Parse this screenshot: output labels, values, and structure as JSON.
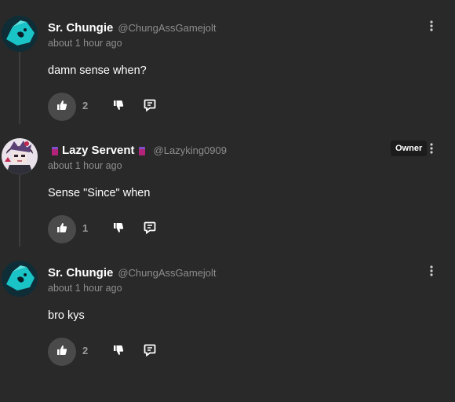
{
  "colors": {
    "background": "#292929",
    "muted_text": "#8d8d8d",
    "like_button_bg": "#4a4a4a",
    "owner_badge_bg": "#1c1c1c",
    "tag_magenta": "#b2247a",
    "tag_purple": "#7d4ec7"
  },
  "comments": [
    {
      "display_name": "Sr. Chungie",
      "username": "@ChungAssGamejolt",
      "timestamp": "about 1 hour ago",
      "body": "damn sense when?",
      "likes": "2",
      "avatar_icon": "teal-creature-avatar",
      "name_decorations": false,
      "badge": ""
    },
    {
      "display_name": "Lazy Servent",
      "username": "@Lazyking0909",
      "timestamp": "about 1 hour ago",
      "body": "Sense \"Since\" when",
      "likes": "1",
      "avatar_icon": "anime-character-avatar",
      "name_decorations": true,
      "badge": "Owner"
    },
    {
      "display_name": "Sr. Chungie",
      "username": "@ChungAssGamejolt",
      "timestamp": "about 1 hour ago",
      "body": "bro kys",
      "likes": "2",
      "avatar_icon": "teal-creature-avatar",
      "name_decorations": false,
      "badge": ""
    }
  ],
  "icons": {
    "like": "thumbs-up-icon",
    "dislike": "thumbs-down-icon",
    "reply": "reply-bubble-icon",
    "more": "vertical-dots-icon"
  }
}
